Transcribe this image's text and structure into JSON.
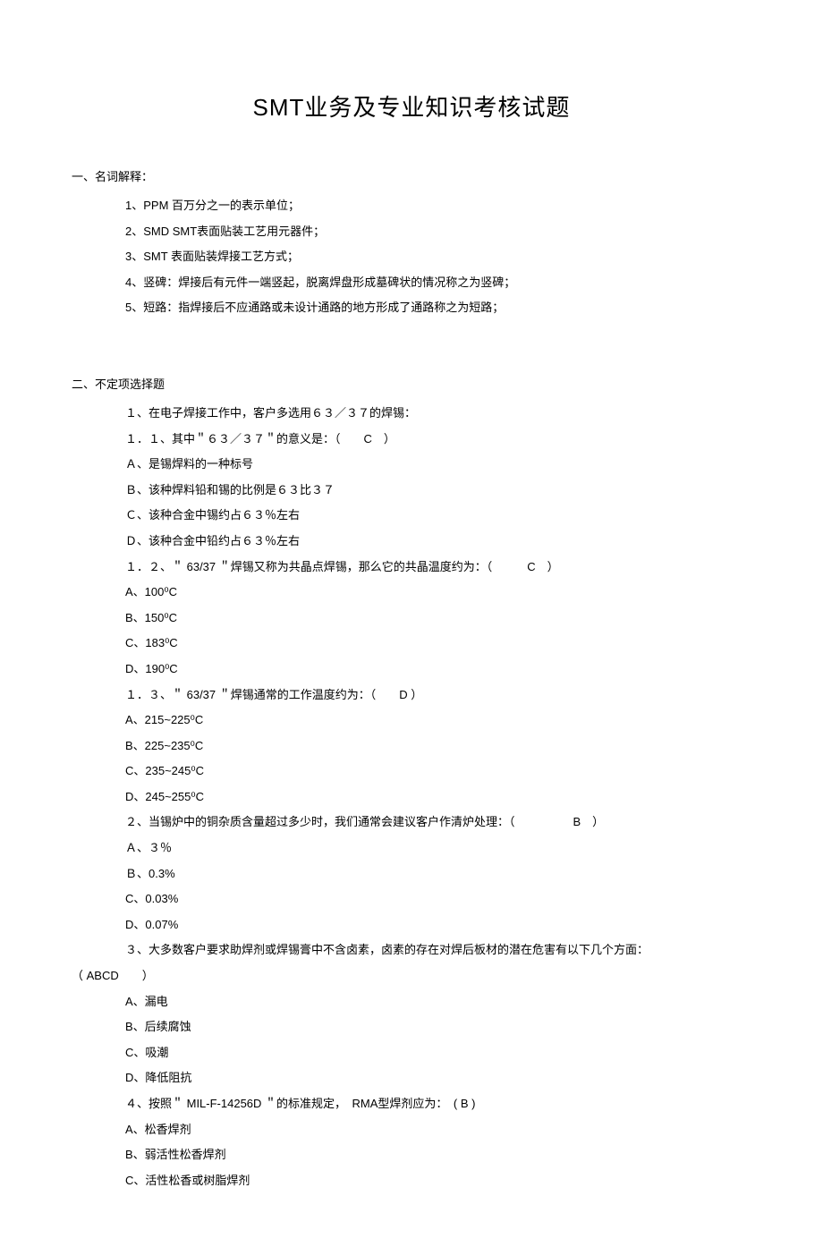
{
  "title": "SMT业务及专业知识考核试题",
  "section1": {
    "header": "一、名词解释：",
    "items": [
      "1、PPM 百万分之一的表示单位；",
      "2、SMD  SMT表面贴装工艺用元器件；",
      "3、SMT  表面贴装焊接工艺方式；",
      "4、竖碑：焊接后有元件一端竖起，脱离焊盘形成墓碑状的情况称之为竖碑；",
      "5、短路：指焊接后不应通路或未设计通路的地方形成了通路称之为短路；"
    ]
  },
  "section2": {
    "header": "二、不定项选择题",
    "q1": {
      "stem": "１、在电子焊接工作中，客户多选用６３／３７的焊锡：",
      "sub1": {
        "label": "１．１、其中＂６３／３７＂的意义是：（　　C　）",
        "optA": "Ａ、是锡焊料的一种标号",
        "optB": "Ｂ、该种焊料铅和锡的比例是６３比３７",
        "optC": "Ｃ、该种合金中锡约占６３％左右",
        "optD": "Ｄ、该种合金中铅约占６３％左右"
      },
      "sub2": {
        "label": "１．２、＂ 63/37 ＂焊锡又称为共晶点焊锡，那么它的共晶温度约为：（　　　C　）",
        "optA": "A、100⁰C",
        "optB": "B、150⁰C",
        "optC": "C、183⁰C",
        "optD": "D、190⁰C"
      },
      "sub3": {
        "label": "１．３、＂ 63/37 ＂焊锡通常的工作温度约为：（　　D  ）",
        "optA": "A、215~225⁰C",
        "optB": "B、225~235⁰C",
        "optC": "C、235~245⁰C",
        "optD": "D、245~255⁰C"
      }
    },
    "q2": {
      "label": "２、当锡炉中的铜杂质含量超过多少时，我们通常会建议客户作清炉处理：（　　　　　B　）",
      "optA": "Ａ、３％",
      "optB": "Ｂ、0.3%",
      "optC": "C、0.03%",
      "optD": "D、0.07%"
    },
    "q3": {
      "label": "３、大多数客户要求助焊剂或焊锡膏中不含卤素，卤素的存在对焊后板材的潜在危害有以下几个方面：",
      "answer": "（  ABCD　　）",
      "optA": "A、漏电",
      "optB": "B、后续腐蚀",
      "optC": "C、吸潮",
      "optD": "D、降低阻抗"
    },
    "q4": {
      "label": "４、按照＂ MIL-F-14256D ＂的标准规定，　RMA型焊剂应为：　( B )",
      "optA": "A、松香焊剂",
      "optB": "B、弱活性松香焊剂",
      "optC": "C、活性松香或树脂焊剂"
    }
  }
}
